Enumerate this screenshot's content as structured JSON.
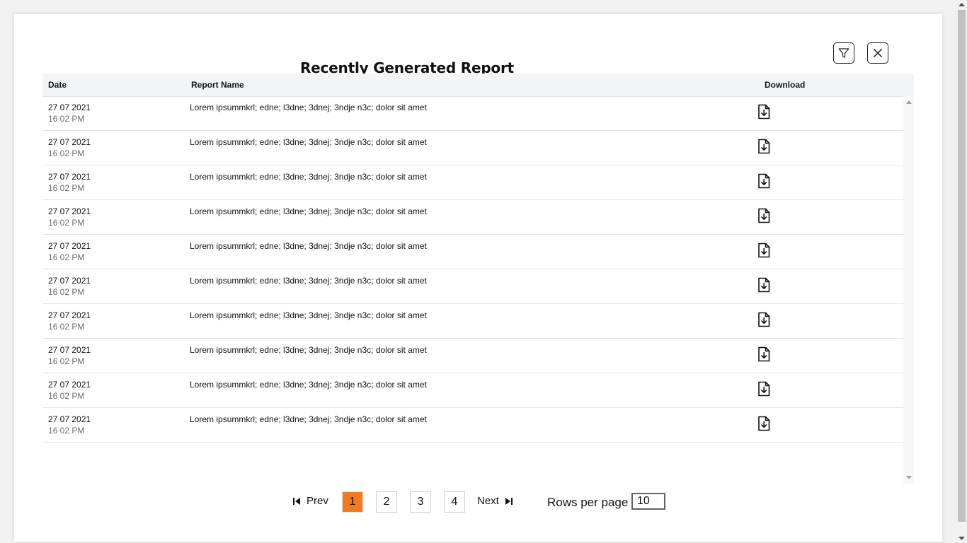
{
  "modal": {
    "title": "Recently Generated Report"
  },
  "header": {
    "filter_icon": "filter-icon",
    "close_icon": "close-icon"
  },
  "table": {
    "columns": [
      "Date",
      "Report Name",
      "Download"
    ],
    "rows": [
      {
        "date": "27 07 2021",
        "time": "16 02 PM",
        "name": "Lorem ipsummkrl; edne; l3dne; 3dnej; 3ndje n3c; dolor sit amet"
      },
      {
        "date": "27 07 2021",
        "time": "16 02 PM",
        "name": "Lorem ipsummkrl; edne; l3dne; 3dnej; 3ndje n3c; dolor sit amet"
      },
      {
        "date": "27 07 2021",
        "time": "16 02 PM",
        "name": "Lorem ipsummkrl; edne; l3dne; 3dnej; 3ndje n3c; dolor sit amet"
      },
      {
        "date": "27 07 2021",
        "time": "16 02 PM",
        "name": "Lorem ipsummkrl; edne; l3dne; 3dnej; 3ndje n3c; dolor sit amet"
      },
      {
        "date": "27 07 2021",
        "time": "16 02 PM",
        "name": "Lorem ipsummkrl; edne; l3dne; 3dnej; 3ndje n3c; dolor sit amet"
      },
      {
        "date": "27 07 2021",
        "time": "16 02 PM",
        "name": "Lorem ipsummkrl; edne; l3dne; 3dnej; 3ndje n3c; dolor sit amet"
      },
      {
        "date": "27 07 2021",
        "time": "16 02 PM",
        "name": "Lorem ipsummkrl; edne; l3dne; 3dnej; 3ndje n3c; dolor sit amet"
      },
      {
        "date": "27 07 2021",
        "time": "16 02 PM",
        "name": "Lorem ipsummkrl; edne; l3dne; 3dnej; 3ndje n3c; dolor sit amet"
      },
      {
        "date": "27 07 2021",
        "time": "16 02 PM",
        "name": "Lorem ipsummkrl; edne; l3dne; 3dnej; 3ndje n3c; dolor sit amet"
      },
      {
        "date": "27 07 2021",
        "time": "16 02 PM",
        "name": "Lorem ipsummkrl; edne; l3dne; 3dnej; 3ndje n3c; dolor sit amet"
      }
    ],
    "download_icon": "file-download-icon"
  },
  "pagination": {
    "prev_label": "Prev",
    "next_label": "Next",
    "pages": [
      "1",
      "2",
      "3",
      "4"
    ],
    "current_page": "1",
    "rows_per_page_label": "Rows per page",
    "rows_per_page_value": "10"
  },
  "colors": {
    "accent": "#f47a20",
    "header_bg": "#f3f4f6",
    "muted_text": "#6b6b6b"
  }
}
